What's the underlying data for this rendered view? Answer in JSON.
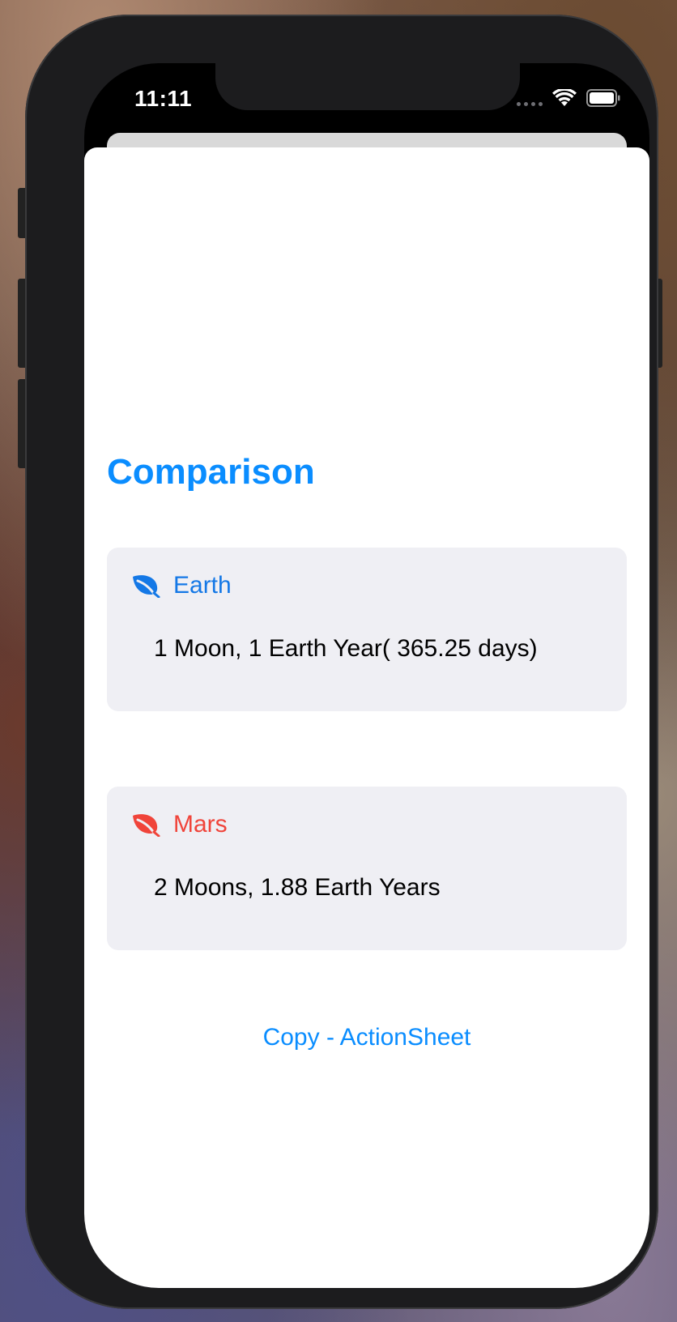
{
  "status_bar": {
    "time": "11:11",
    "icons": [
      "cellular-signal-icon",
      "wifi-icon",
      "battery-icon"
    ]
  },
  "page": {
    "title": "Comparison"
  },
  "cards": [
    {
      "icon": "leaf-icon",
      "label": "Earth",
      "detail": "1 Moon, 1 Earth Year( 365.25 days)",
      "color": "#1478e6"
    },
    {
      "icon": "leaf-icon",
      "label": "Mars",
      "detail": "2 Moons, 1.88 Earth Years",
      "color": "#f0443a"
    }
  ],
  "action": {
    "label": "Copy - ActionSheet",
    "color": "#0a8dff"
  },
  "colors": {
    "title": "#0a8dff",
    "card_background": "#efeff4",
    "sheet_background": "#ffffff"
  }
}
